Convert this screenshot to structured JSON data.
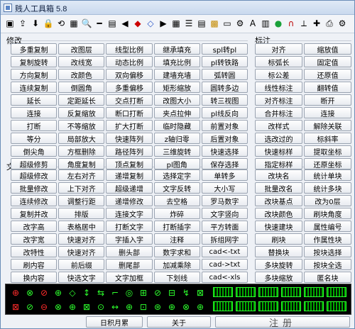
{
  "window": {
    "title": "贱人工具箱 5.8"
  },
  "toolbar": {
    "icons": [
      "save-icon",
      "export-icon",
      "import-icon",
      "lock-icon",
      "undo-icon",
      "table-icon",
      "zoom-icon",
      "ruler-icon",
      "block-icon",
      "arrow-left-icon",
      "layer-red-icon",
      "layer-blue-icon",
      "arrow-right-icon",
      "grid-icon",
      "align-icon",
      "sheet-icon",
      "color-grid-icon",
      "rect-icon",
      "settings-icon",
      "text-icon",
      "layers-icon",
      "green-icon",
      "magnet-icon",
      "measure-icon",
      "cross-icon",
      "print-icon",
      "gear-icon"
    ]
  },
  "sections": {
    "modify": "修改",
    "mark": "标注",
    "text": "文字",
    "block": "块"
  },
  "modify_buttons": [
    [
      "多重复制",
      "改图层",
      "线型比例",
      "继承填充",
      "spl转pl"
    ],
    [
      "复制旋转",
      "改线宽",
      "动态比例",
      "填充比例",
      "pl转铁路"
    ],
    [
      "方向复制",
      "改颜色",
      "双向偏移",
      "建墙充墙",
      "弧转圆"
    ],
    [
      "连续复制",
      "倒圆角",
      "多重偏移",
      "矩形缩放",
      "圆转多边"
    ],
    [
      "延长",
      "定距延长",
      "交点打断",
      "改图大小",
      "转三视图"
    ],
    [
      "连接",
      "反复缩放",
      "断口打断",
      "夹点拉伸",
      "pl线反向"
    ],
    [
      "打断",
      "不等缩放",
      "扩大打断",
      "临时隐藏",
      "前置对象"
    ],
    [
      "等分",
      "局部放大",
      "快速阵列",
      "z轴归零",
      "后置对象"
    ],
    [
      "倒尖角",
      "方框删除",
      "路径阵列",
      "三维旋转",
      "快速选择"
    ],
    [
      "超级修剪",
      "角度复制",
      "顶点复制",
      "pl图角",
      "保存选择"
    ]
  ],
  "mark_buttons": [
    [
      "对齐",
      "缩放值"
    ],
    [
      "标弧长",
      "固定值"
    ],
    [
      "标公差",
      "还原值"
    ],
    [
      "线性标注",
      "翻转值"
    ],
    [
      "对齐标注",
      "断开"
    ],
    [
      "合并标注",
      "连接"
    ],
    [
      "改样式",
      "解除关联"
    ],
    [
      "选改过的",
      "标斜率"
    ],
    [
      "快速标样",
      "提取坐标"
    ],
    [
      "指定标样",
      "还原坐标"
    ]
  ],
  "text_buttons": [
    [
      "超级修改",
      "左右对齐",
      "递增复制",
      "选择定字",
      "单转多"
    ],
    [
      "批量修改",
      "上下对齐",
      "超级递增",
      "文字反转",
      "大小写"
    ],
    [
      "连续修改",
      "调整行距",
      "递增修改",
      "去空格",
      "罗马数字"
    ],
    [
      "复制并改",
      "排版",
      "连接文字",
      "炸碎",
      "文字竖向"
    ],
    [
      "改字高",
      "表格居中",
      "打断文字",
      "打断插字",
      "平方转面"
    ],
    [
      "改字宽",
      "快速对齐",
      "字插入字",
      "注释",
      "拆组网字"
    ],
    [
      "改特性",
      "快速对齐",
      "删头部",
      "数字求和",
      "cad<-txt"
    ],
    [
      "刷内容",
      "前后缀",
      "删尾部",
      "加减乘除",
      "cad->txt"
    ],
    [
      "换内容",
      "快选文字",
      "文字加框",
      "下划线",
      "cad<-xls"
    ],
    [
      "常用词库",
      "指定文样",
      "编号",
      "图名线",
      "cad->xls"
    ]
  ],
  "block_buttons": [
    [
      "改块名",
      "统计单块"
    ],
    [
      "批量改名",
      "统计多块"
    ],
    [
      "改块基点",
      "改为0层"
    ],
    [
      "改块颜色",
      "刷块角度"
    ],
    [
      "快速建块",
      "属性编号"
    ],
    [
      "刷块",
      "作属性块"
    ],
    [
      "替换块",
      "按块选择"
    ],
    [
      "多块旋转",
      "按块全选"
    ],
    [
      "多块缩放",
      "匿名块"
    ],
    [
      "常用块",
      "块连线"
    ]
  ],
  "preview": {
    "cells": [
      "⊕",
      "⊗",
      "⊘",
      "⊕",
      "◇",
      "↕",
      "⇆",
      "⌐",
      "◎",
      "⊞",
      "⊘",
      "⊟",
      "↯",
      "⊠"
    ],
    "cells2": [
      "⊠",
      "⊘",
      "⊖",
      "⊗",
      "⊕",
      "⊠",
      "⊙",
      "↔",
      "⊕",
      "⊡",
      "⊛",
      "⊕",
      "⊗",
      "⊕"
    ]
  },
  "bottom": {
    "left_label": "日积月累",
    "about_label": "关于",
    "right_label": "注册"
  }
}
